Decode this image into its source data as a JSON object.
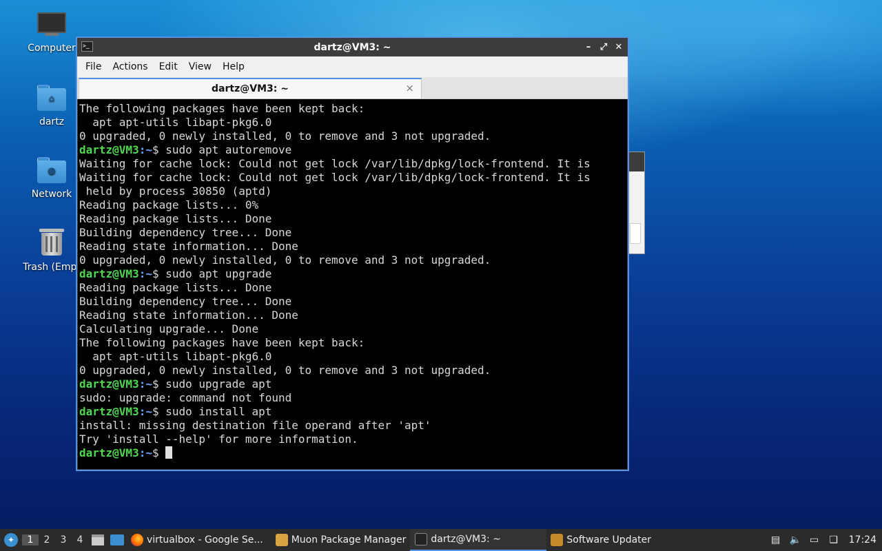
{
  "desktop": {
    "icons": [
      {
        "label": "Computer",
        "icon": "computer-icon"
      },
      {
        "label": "dartz",
        "icon": "home-folder-icon"
      },
      {
        "label": "Network",
        "icon": "network-folder-icon"
      },
      {
        "label": "Trash (Empt",
        "icon": "trash-icon"
      }
    ]
  },
  "window": {
    "title": "dartz@VM3: ~",
    "menu": [
      "File",
      "Actions",
      "Edit",
      "View",
      "Help"
    ],
    "tab_title": "dartz@VM3: ~",
    "tab_close": "×",
    "controls": {
      "minimize": "–",
      "maximize": "⤢",
      "close": "✕"
    }
  },
  "terminal": {
    "prompt_user": "dartz@VM3",
    "prompt_path": ":~",
    "prompt_symbol": "$ ",
    "lines": [
      {
        "t": "out",
        "text": "The following packages have been kept back:"
      },
      {
        "t": "out",
        "text": "  apt apt-utils libapt-pkg6.0"
      },
      {
        "t": "out",
        "text": "0 upgraded, 0 newly installed, 0 to remove and 3 not upgraded."
      },
      {
        "t": "cmd",
        "text": "sudo apt autoremove"
      },
      {
        "t": "out",
        "text": "Waiting for cache lock: Could not get lock /var/lib/dpkg/lock-frontend. It is"
      },
      {
        "t": "out",
        "text": "Waiting for cache lock: Could not get lock /var/lib/dpkg/lock-frontend. It is"
      },
      {
        "t": "out",
        "text": " held by process 30850 (aptd)"
      },
      {
        "t": "out",
        "text": "Reading package lists... 0%"
      },
      {
        "t": "out",
        "text": "Reading package lists... Done"
      },
      {
        "t": "out",
        "text": "Building dependency tree... Done"
      },
      {
        "t": "out",
        "text": "Reading state information... Done"
      },
      {
        "t": "out",
        "text": "0 upgraded, 0 newly installed, 0 to remove and 3 not upgraded."
      },
      {
        "t": "cmd",
        "text": "sudo apt upgrade"
      },
      {
        "t": "out",
        "text": "Reading package lists... Done"
      },
      {
        "t": "out",
        "text": "Building dependency tree... Done"
      },
      {
        "t": "out",
        "text": "Reading state information... Done"
      },
      {
        "t": "out",
        "text": "Calculating upgrade... Done"
      },
      {
        "t": "out",
        "text": "The following packages have been kept back:"
      },
      {
        "t": "out",
        "text": "  apt apt-utils libapt-pkg6.0"
      },
      {
        "t": "out",
        "text": "0 upgraded, 0 newly installed, 0 to remove and 3 not upgraded."
      },
      {
        "t": "cmd",
        "text": "sudo upgrade apt"
      },
      {
        "t": "out",
        "text": "sudo: upgrade: command not found"
      },
      {
        "t": "cmd",
        "text": "sudo install apt"
      },
      {
        "t": "out",
        "text": "install: missing destination file operand after 'apt'"
      },
      {
        "t": "out",
        "text": "Try 'install --help' for more information."
      },
      {
        "t": "cmd",
        "text": "",
        "cursor": true
      }
    ]
  },
  "taskbar": {
    "workspaces": [
      "1",
      "2",
      "3",
      "4"
    ],
    "active_workspace": "1",
    "tasks": [
      {
        "label": "virtualbox - Google Se...",
        "icon": "firefox-icon",
        "active": false
      },
      {
        "label": "Muon Package Manager",
        "icon": "muon-icon",
        "active": false
      },
      {
        "label": "dartz@VM3: ~",
        "icon": "terminal-icon",
        "active": true
      },
      {
        "label": "Software Updater",
        "icon": "software-updater-icon",
        "active": false
      }
    ],
    "clock": "17:24"
  },
  "colors": {
    "prompt_user": "#4fd84f",
    "prompt_path": "#6ea6ff",
    "accent": "#5294e2"
  }
}
